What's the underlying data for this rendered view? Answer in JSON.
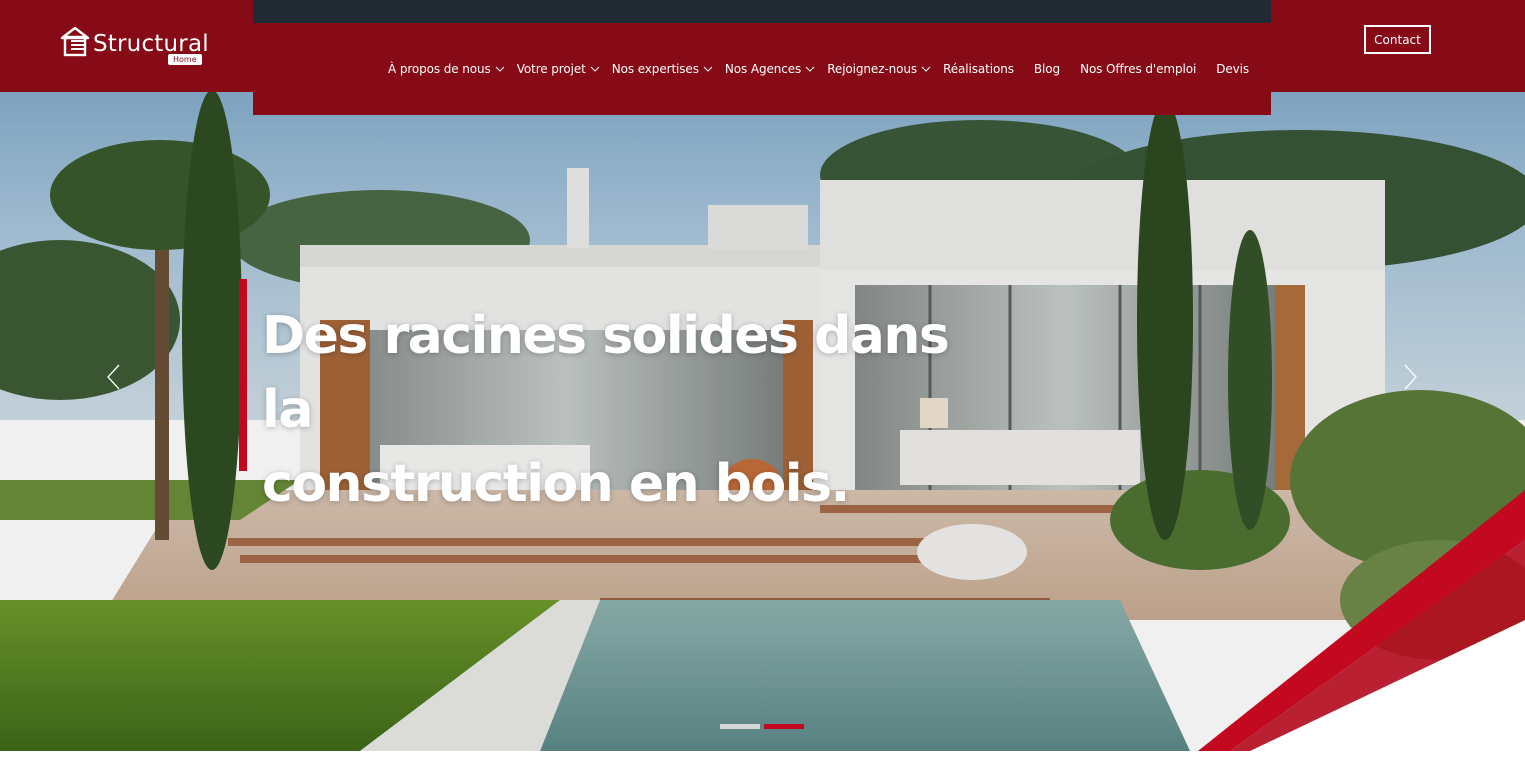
{
  "brand": {
    "name": "Structural",
    "sub": "Home",
    "primary_color": "#870b17",
    "accent_color": "#c3091f",
    "logo_icon": "house-icon"
  },
  "nav": {
    "items": [
      {
        "label": "À propos de nous",
        "dropdown": true
      },
      {
        "label": "Votre projet",
        "dropdown": true
      },
      {
        "label": "Nos expertises",
        "dropdown": true
      },
      {
        "label": "Nos Agences",
        "dropdown": true
      },
      {
        "label": "Rejoignez-nous",
        "dropdown": true
      },
      {
        "label": "Réalisations",
        "dropdown": false
      },
      {
        "label": "Blog",
        "dropdown": false
      },
      {
        "label": "Nos Offres d'emploi",
        "dropdown": false
      },
      {
        "label": "Devis",
        "dropdown": false
      }
    ],
    "dropdown_icon": "chevron-down-icon"
  },
  "header": {
    "contact_label": "Contact"
  },
  "hero": {
    "title_line1": "Des racines solides dans la",
    "title_line2": "construction en bois.",
    "image": "modern-house-with-terrace-and-pool",
    "prev_icon": "chevron-left-icon",
    "next_icon": "chevron-right-icon",
    "slides_total": 2,
    "active_slide": 2
  }
}
